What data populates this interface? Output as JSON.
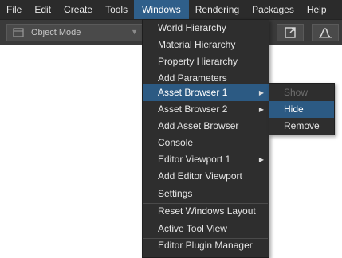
{
  "menubar": {
    "items": [
      "File",
      "Edit",
      "Create",
      "Tools",
      "Windows",
      "Rendering",
      "Packages",
      "Help"
    ],
    "active": "Windows"
  },
  "toolbar": {
    "mode_label": "Object Mode"
  },
  "windows_menu": {
    "items": [
      {
        "label": "World Hierarchy"
      },
      {
        "label": "Material Hierarchy"
      },
      {
        "label": "Property Hierarchy"
      },
      {
        "label": "Add Parameters"
      },
      {
        "label": "Asset Browser 1",
        "submenu": true,
        "highlighted": true
      },
      {
        "label": "Asset Browser 2",
        "submenu": true
      },
      {
        "label": "Add Asset Browser"
      },
      {
        "label": "Console"
      },
      {
        "label": "Editor Viewport 1",
        "submenu": true
      },
      {
        "label": "Add Editor Viewport"
      },
      {
        "label": "Settings"
      },
      {
        "label": "Reset Windows Layout"
      },
      {
        "label": "Active Tool View"
      },
      {
        "label": "Editor Plugin Manager"
      }
    ]
  },
  "asset_browser_submenu": {
    "items": [
      {
        "label": "Show",
        "disabled": true
      },
      {
        "label": "Hide",
        "highlighted": true
      },
      {
        "label": "Remove"
      }
    ]
  },
  "colors": {
    "menubar_bg": "#2b2b2b",
    "highlight": "#2c5a83",
    "menu_bg": "#2e2e2e"
  }
}
